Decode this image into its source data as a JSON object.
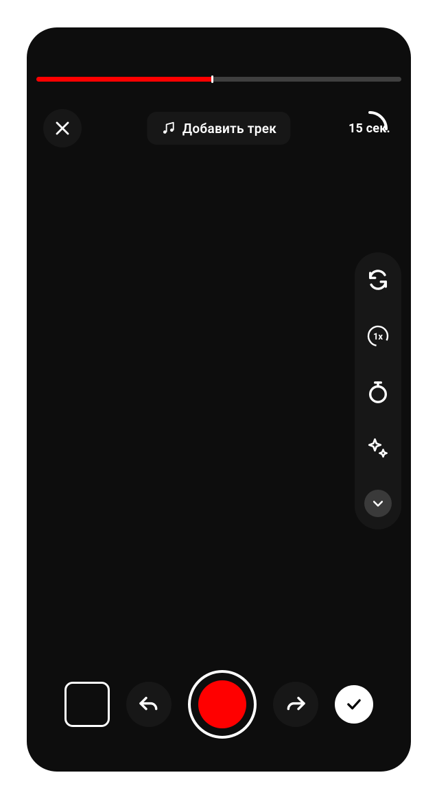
{
  "progress": {
    "percent": 48,
    "marker_percent": 48
  },
  "top": {
    "add_track_label": "Добавить трек",
    "duration_label": "15 сек."
  },
  "tools": {
    "flip": "flip-camera",
    "speed_label": "1x",
    "timer": "timer",
    "effects": "effects",
    "expand": "expand"
  },
  "bottom": {
    "gallery": "gallery",
    "undo": "undo",
    "record": "record",
    "redo": "redo",
    "confirm": "confirm"
  }
}
